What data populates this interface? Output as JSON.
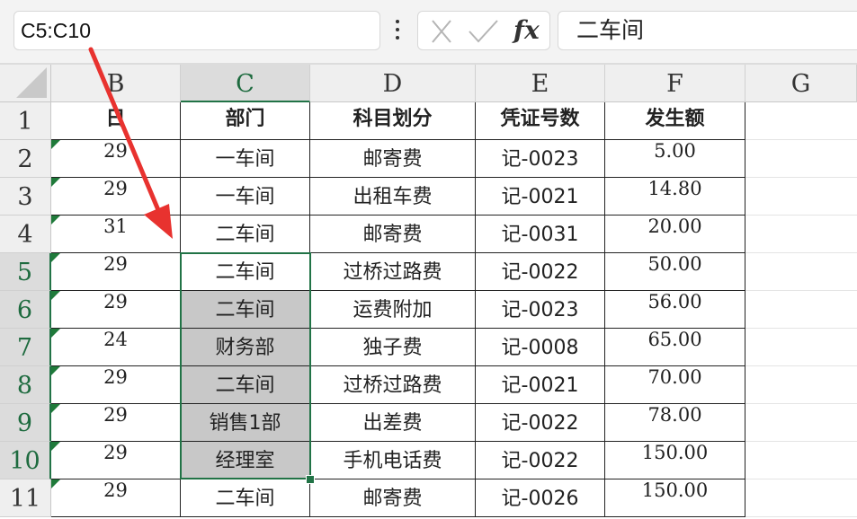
{
  "formula_bar": {
    "name_box": "C5:C10",
    "cancel_icon": "close-icon",
    "confirm_icon": "check-icon",
    "fx_label": "fx",
    "formula_value": "二车间"
  },
  "columns": [
    "B",
    "C",
    "D",
    "E",
    "F",
    "G"
  ],
  "selected_column": "C",
  "selected_rows": [
    5,
    6,
    7,
    8,
    9,
    10
  ],
  "header_row": {
    "row": "1",
    "cells": [
      "日",
      "部门",
      "科目划分",
      "凭证号数",
      "发生额"
    ]
  },
  "rows": [
    {
      "row": "2",
      "cells": [
        "29",
        "一车间",
        "邮寄费",
        "记-0023",
        "5.00"
      ]
    },
    {
      "row": "3",
      "cells": [
        "29",
        "一车间",
        "出租车费",
        "记-0021",
        "14.80"
      ]
    },
    {
      "row": "4",
      "cells": [
        "31",
        "二车间",
        "邮寄费",
        "记-0031",
        "20.00"
      ]
    },
    {
      "row": "5",
      "cells": [
        "29",
        "二车间",
        "过桥过路费",
        "记-0022",
        "50.00"
      ]
    },
    {
      "row": "6",
      "cells": [
        "29",
        "二车间",
        "运费附加",
        "记-0023",
        "56.00"
      ]
    },
    {
      "row": "7",
      "cells": [
        "24",
        "财务部",
        "独子费",
        "记-0008",
        "65.00"
      ]
    },
    {
      "row": "8",
      "cells": [
        "29",
        "二车间",
        "过桥过路费",
        "记-0021",
        "70.00"
      ]
    },
    {
      "row": "9",
      "cells": [
        "29",
        "销售1部",
        "出差费",
        "记-0022",
        "78.00"
      ]
    },
    {
      "row": "10",
      "cells": [
        "29",
        "经理室",
        "手机电话费",
        "记-0022",
        "150.00"
      ]
    },
    {
      "row": "11",
      "cells": [
        "29",
        "二车间",
        "邮寄费",
        "记-0026",
        "150.00"
      ]
    }
  ],
  "colors": {
    "accent": "#217346",
    "arrow": "#e8322f",
    "selection_fill": "#c8c8c8",
    "header_bg": "#efefef"
  }
}
